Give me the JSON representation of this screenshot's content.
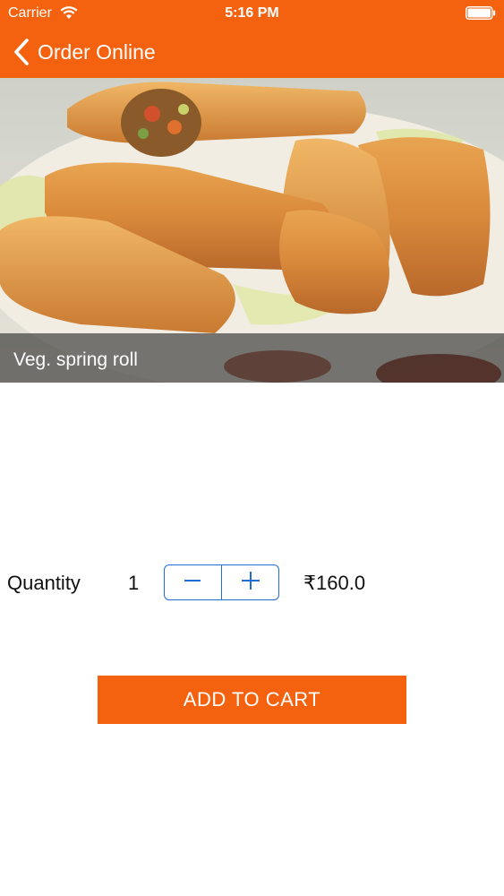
{
  "status_bar": {
    "carrier": "Carrier",
    "time": "5:16 PM",
    "icons": [
      "wifi-icon",
      "battery-icon"
    ]
  },
  "nav": {
    "back_label": "Order Online",
    "back_icon": "chevron-left-icon"
  },
  "hero": {
    "caption": "Veg. spring roll"
  },
  "order": {
    "quantity_label": "Quantity",
    "quantity_value": "1",
    "price": "₹160.0",
    "stepper_icons": [
      "minus-icon",
      "plus-icon"
    ]
  },
  "actions": {
    "add_to_cart": "ADD TO CART"
  },
  "colors": {
    "accent": "#f5620f",
    "stepper": "#1d6fd6",
    "text": "#111111"
  }
}
